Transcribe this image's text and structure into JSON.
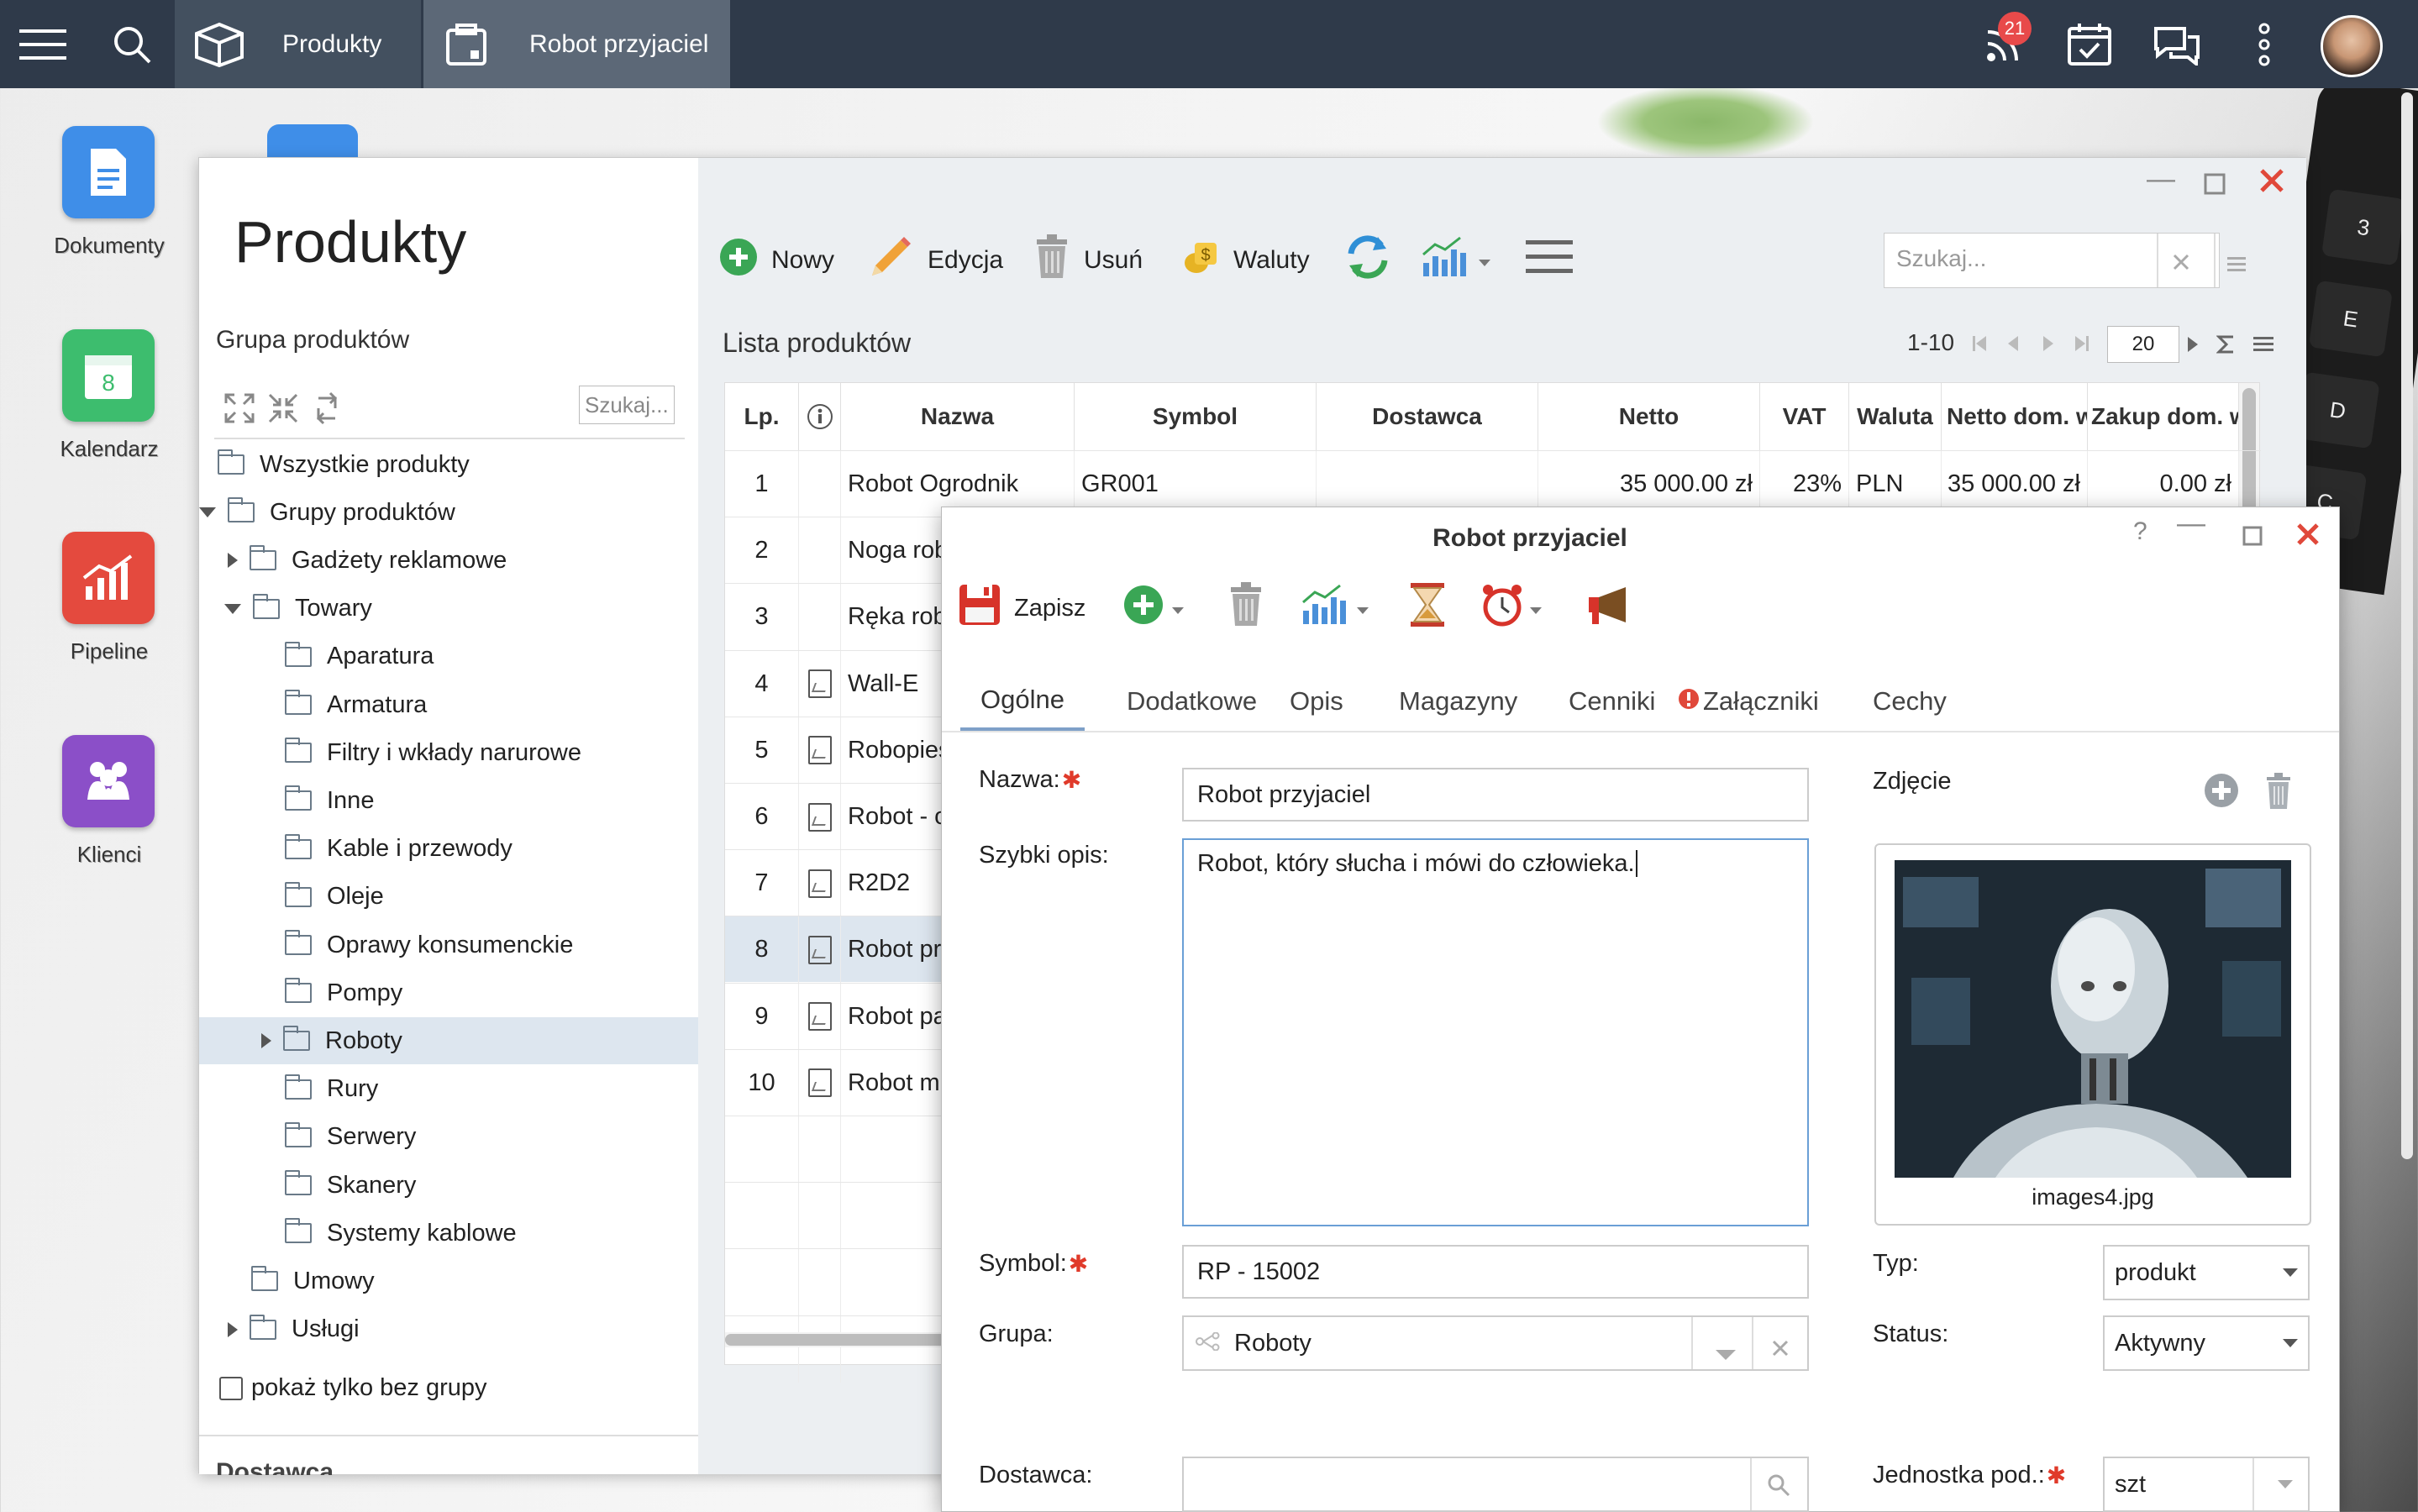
{
  "topbar": {
    "tabs": [
      {
        "label": "Produkty"
      },
      {
        "label": "Robot przyjaciel"
      }
    ],
    "notifications_count": "21"
  },
  "desktop": {
    "launchers": [
      {
        "label": "Dokumenty",
        "color": "#3f8ee8"
      },
      {
        "label": "Kalendarz",
        "color": "#3dbd6e"
      },
      {
        "label": "Pipeline",
        "color": "#e44a3e"
      },
      {
        "label": "Klienci",
        "color": "#8b4fc8"
      }
    ],
    "keyboard_keys": [
      "3",
      "E",
      "D",
      "C"
    ]
  },
  "products": {
    "title": "Produkty",
    "group_heading": "Grupa produktów",
    "tree_search_placeholder": "Szukaj...",
    "tree": [
      {
        "label": "Wszystkie produkty",
        "level": 0,
        "caret": "none"
      },
      {
        "label": "Grupy produktów",
        "level": 0,
        "caret": "down"
      },
      {
        "label": "Gadżety reklamowe",
        "level": 1,
        "caret": "right"
      },
      {
        "label": "Towary",
        "level": 1,
        "caret": "down"
      },
      {
        "label": "Aparatura",
        "level": 2,
        "caret": "none"
      },
      {
        "label": "Armatura",
        "level": 2,
        "caret": "none"
      },
      {
        "label": "Filtry i wkłady narurowe",
        "level": 2,
        "caret": "none"
      },
      {
        "label": "Inne",
        "level": 2,
        "caret": "none"
      },
      {
        "label": "Kable i przewody",
        "level": 2,
        "caret": "none"
      },
      {
        "label": "Oleje",
        "level": 2,
        "caret": "none"
      },
      {
        "label": "Oprawy konsumenckie",
        "level": 2,
        "caret": "none"
      },
      {
        "label": "Pompy",
        "level": 2,
        "caret": "none"
      },
      {
        "label": "Roboty",
        "level": 2,
        "caret": "right",
        "selected": true
      },
      {
        "label": "Rury",
        "level": 2,
        "caret": "none"
      },
      {
        "label": "Serwery",
        "level": 2,
        "caret": "none"
      },
      {
        "label": "Skanery",
        "level": 2,
        "caret": "none"
      },
      {
        "label": "Systemy kablowe",
        "level": 2,
        "caret": "none"
      },
      {
        "label": "Umowy",
        "level": 1,
        "caret": "none"
      },
      {
        "label": "Usługi",
        "level": 1,
        "caret": "right"
      }
    ],
    "only_without_group_label": "pokaż tylko bez grupy",
    "next_section_label": "Dostawca",
    "toolbar": {
      "new_label": "Nowy",
      "edit_label": "Edycja",
      "delete_label": "Usuń",
      "currency_label": "Waluty"
    },
    "search_placeholder": "Szukaj...",
    "list_heading": "Lista produktów",
    "pager_range": "1-10",
    "page_size": "20",
    "columns": [
      "Lp.",
      "Nazwa",
      "Symbol",
      "Dostawca",
      "Netto",
      "VAT",
      "Waluta",
      "Netto dom. w",
      "Zakup dom. w"
    ],
    "rows": [
      {
        "lp": "1",
        "name": "Robot Ogrodnik",
        "symbol": "GR001",
        "supplier": "",
        "net": "35 000.00 zł",
        "vat": "23%",
        "currency": "PLN",
        "net_dom": "35 000.00 zł",
        "buy_dom": "0.00 zł",
        "icon": false
      },
      {
        "lp": "2",
        "name": "Noga rob",
        "symbol": "",
        "supplier": "",
        "net": "",
        "vat": "",
        "currency": "",
        "net_dom": "",
        "buy_dom": "",
        "icon": false
      },
      {
        "lp": "3",
        "name": "Ręka robo",
        "symbol": "",
        "supplier": "",
        "net": "",
        "vat": "",
        "currency": "",
        "net_dom": "",
        "buy_dom": "",
        "icon": false
      },
      {
        "lp": "4",
        "name": "Wall-E",
        "symbol": "",
        "supplier": "",
        "net": "",
        "vat": "",
        "currency": "",
        "net_dom": "",
        "buy_dom": "",
        "icon": true
      },
      {
        "lp": "5",
        "name": "Robopies",
        "symbol": "",
        "supplier": "",
        "net": "",
        "vat": "",
        "currency": "",
        "net_dom": "",
        "buy_dom": "",
        "icon": true
      },
      {
        "lp": "6",
        "name": "Robot - o",
        "symbol": "",
        "supplier": "",
        "net": "",
        "vat": "",
        "currency": "",
        "net_dom": "",
        "buy_dom": "",
        "icon": true
      },
      {
        "lp": "7",
        "name": "R2D2",
        "symbol": "",
        "supplier": "",
        "net": "",
        "vat": "",
        "currency": "",
        "net_dom": "",
        "buy_dom": "",
        "icon": true
      },
      {
        "lp": "8",
        "name": "Robot prz",
        "symbol": "",
        "supplier": "",
        "net": "",
        "vat": "",
        "currency": "",
        "net_dom": "",
        "buy_dom": "",
        "icon": true,
        "selected": true
      },
      {
        "lp": "9",
        "name": "Robot pa",
        "symbol": "",
        "supplier": "",
        "net": "",
        "vat": "",
        "currency": "",
        "net_dom": "",
        "buy_dom": "",
        "icon": true
      },
      {
        "lp": "10",
        "name": "Robot mu",
        "symbol": "",
        "supplier": "",
        "net": "",
        "vat": "",
        "currency": "",
        "net_dom": "",
        "buy_dom": "",
        "icon": true
      }
    ]
  },
  "detail": {
    "title": "Robot przyjaciel",
    "save_label": "Zapisz",
    "tabs": [
      "Ogólne",
      "Dodatkowe",
      "Opis",
      "Magazyny",
      "Cenniki",
      "Załączniki",
      "Cechy"
    ],
    "fields": {
      "name_label": "Nazwa:",
      "name_value": "Robot przyjaciel",
      "short_desc_label": "Szybki opis:",
      "short_desc_value": "Robot, który słucha i mówi do człowieka.",
      "symbol_label": "Symbol:",
      "symbol_value": "RP - 15002",
      "group_label": "Grupa:",
      "group_value": "Roboty",
      "supplier_label": "Dostawca:",
      "supplier_value": "",
      "photo_label": "Zdjęcie",
      "photo_filename": "images4.jpg",
      "type_label": "Typ:",
      "type_value": "produkt",
      "status_label": "Status:",
      "status_value": "Aktywny",
      "unit_label": "Jednostka pod.:",
      "unit_value": "szt"
    }
  }
}
